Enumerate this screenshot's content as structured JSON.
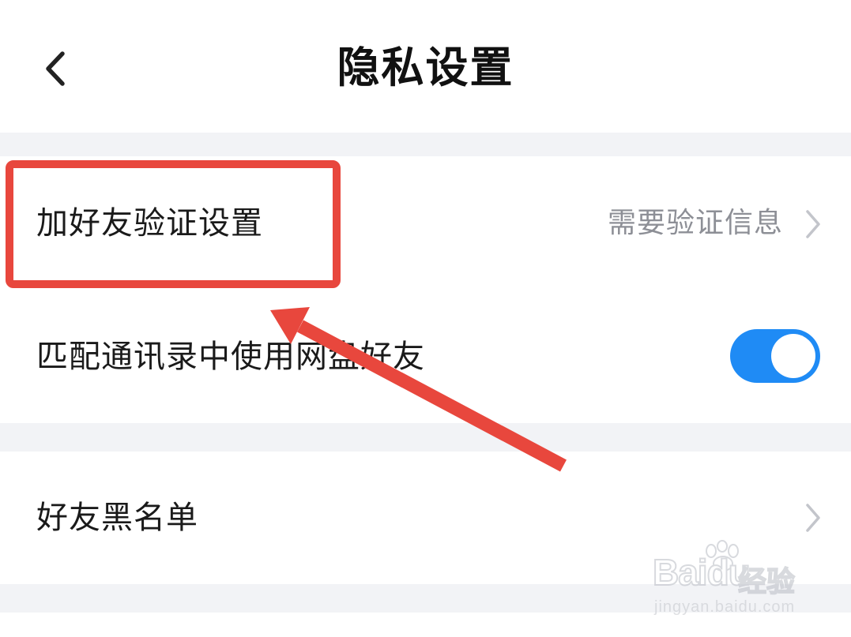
{
  "header": {
    "back_icon": "chevron-left-icon",
    "title": "隐私设置"
  },
  "settings": {
    "friend_verification": {
      "label": "加好友验证设置",
      "value": "需要验证信息",
      "icon": "chevron-right-icon"
    },
    "match_contacts": {
      "label": "匹配通讯录中使用网盘好友",
      "toggle_on": true
    },
    "blacklist": {
      "label": "好友黑名单",
      "icon": "chevron-right-icon"
    }
  },
  "annotation": {
    "highlight_color": "#e8473d",
    "arrow_color": "#e8473d"
  },
  "watermark": {
    "brand": "Bai",
    "brand_suffix": "du",
    "brand_cn": "经验",
    "url": "jingyan.baidu.com"
  },
  "colors": {
    "accent": "#1f8bf5",
    "background_gap": "#f2f3f6",
    "secondary_text": "#8d8f96"
  }
}
